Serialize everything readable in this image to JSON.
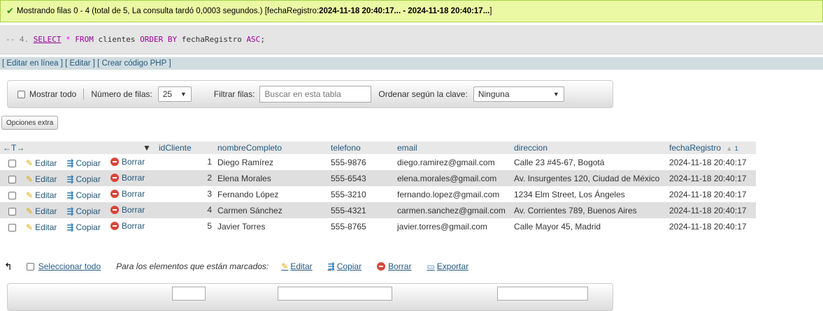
{
  "status": {
    "prefix": "Mostrando filas 0 - 4 (total de 5, La consulta tardó 0,0003 segundos.) [fechaRegistro: ",
    "range": "2024-11-18 20:40:17... - 2024-11-18 20:40:17...",
    "suffix": "]"
  },
  "sql": {
    "comment": "-- 4.",
    "select": "SELECT",
    "star": "*",
    "from": "FROM",
    "table": "clientes",
    "order": "ORDER BY",
    "column": "fechaRegistro",
    "asc": "ASC",
    "end": ";"
  },
  "links": {
    "edit_inline": "Editar en línea",
    "edit": "Editar",
    "create_php": "Crear código PHP"
  },
  "nav": {
    "show_all": "Mostrar todo",
    "rows_label": "Número de filas:",
    "rows_value": "25",
    "filter_label": "Filtrar filas:",
    "filter_placeholder": "Buscar en esta tabla",
    "sort_label": "Ordenar según la clave:",
    "sort_value": "Ninguna"
  },
  "extra_options": "Opciones extra",
  "table": {
    "headers": [
      "idCliente",
      "nombreCompleto",
      "telefono",
      "email",
      "direccion",
      "fechaRegistro"
    ],
    "sort_indicator": "1",
    "action_labels": {
      "edit": "Editar",
      "copy": "Copiar",
      "delete": "Borrar"
    },
    "rows": [
      {
        "id": "1",
        "nombre": "Diego Ramírez",
        "telefono": "555-9876",
        "email": "diego.ramirez@gmail.com",
        "direccion": "Calle 23 #45-67, Bogotá",
        "fecha": "2024-11-18 20:40:17"
      },
      {
        "id": "2",
        "nombre": "Elena Morales",
        "telefono": "555-6543",
        "email": "elena.morales@gmail.com",
        "direccion": "Av. Insurgentes 120, Ciudad de México",
        "fecha": "2024-11-18 20:40:17"
      },
      {
        "id": "3",
        "nombre": "Fernando López",
        "telefono": "555-3210",
        "email": "fernando.lopez@gmail.com",
        "direccion": "1234 Elm Street, Los Ángeles",
        "fecha": "2024-11-18 20:40:17"
      },
      {
        "id": "4",
        "nombre": "Carmen Sánchez",
        "telefono": "555-4321",
        "email": "carmen.sanchez@gmail.com",
        "direccion": "Av. Corrientes 789, Buenos Aires",
        "fecha": "2024-11-18 20:40:17"
      },
      {
        "id": "5",
        "nombre": "Javier Torres",
        "telefono": "555-8765",
        "email": "javier.torres@gmail.com",
        "direccion": "Calle Mayor 45, Madrid",
        "fecha": "2024-11-18 20:40:17"
      }
    ]
  },
  "footer": {
    "select_all": "Seleccionar todo",
    "marked_label": "Para los elementos que están marcados:",
    "edit": "Editar",
    "copy": "Copiar",
    "delete": "Borrar",
    "export": "Exportar"
  }
}
